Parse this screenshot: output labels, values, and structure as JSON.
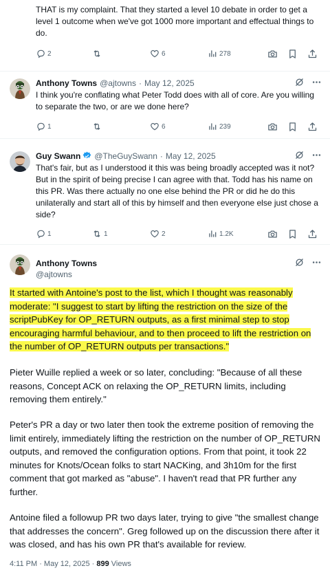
{
  "reply1": {
    "text": "THAT is my complaint. That they started a level 10 debate in order to get a level 1 outcome when we've got 1000 more important and effectual things to do.",
    "replies": "2",
    "reposts": "",
    "likes": "6",
    "views": "278"
  },
  "reply2": {
    "name": "Anthony Towns",
    "handle": "@ajtowns",
    "date": "May 12, 2025",
    "text": "I think you're conflating what Peter Todd does with all of core. Are you willing to separate the two, or are we done here?",
    "replies": "1",
    "reposts": "",
    "likes": "6",
    "views": "239"
  },
  "reply3": {
    "name": "Guy Swann",
    "handle": "@TheGuySwann",
    "date": "May 12, 2025",
    "text": "That's fair, but as I understood it this was being broadly accepted was it not? But in the spirit of being precise I can agree with that. Todd has his name on this PR. Was there actually no one else behind the PR or did he do this unilaterally and start all of this by himself and then everyone else just chose a side?",
    "replies": "1",
    "reposts": "1",
    "likes": "2",
    "views": "1.2K"
  },
  "main": {
    "name": "Anthony Towns",
    "handle": "@ajtowns",
    "highlighted": "It started with Antoine's post to the list, which I thought was reasonably moderate: \"I suggest to start by lifting the restriction on the size of the scriptPubKey for OP_RETURN outputs, as a first minimal step to stop encouraging harmful behaviour, and to then proceed to lift the restriction on the number of OP_RETURN outputs per transactions.\"",
    "para2": "Pieter Wuille replied a week or so later, concluding: \"Because of all these reasons, Concept ACK on relaxing the OP_RETURN limits, including removing them entirely.\"",
    "para3": "Peter's PR a day or two later then took the extreme position of removing the limit entirely, immediately lifting the restriction on the number of OP_RETURN outputs, and removed the configuration options. From that point, it took 22 minutes for Knots/Ocean folks to start NACKing, and 3h10m for the first comment that got marked as \"abuse\". I haven't read that PR further any further.",
    "para4": "Antoine filed a followup PR two days later, trying to give \"the smallest change that addresses the concern\". Greg followed up on the discussion there after it was closed, and has his own PR that's available for review.",
    "time": "4:11 PM · May 12, 2025 · ",
    "views": "899",
    "views_label": "Views"
  },
  "separator": "·",
  "colors": {
    "verified": "#1d9bf0",
    "highlight": "#fbf94a",
    "muted": "#536471"
  },
  "icons": [
    "reply-icon",
    "repost-icon",
    "like-icon",
    "views-icon",
    "camera-icon",
    "bookmark-icon",
    "share-icon",
    "grok-icon",
    "more-icon",
    "verified-badge-icon"
  ]
}
